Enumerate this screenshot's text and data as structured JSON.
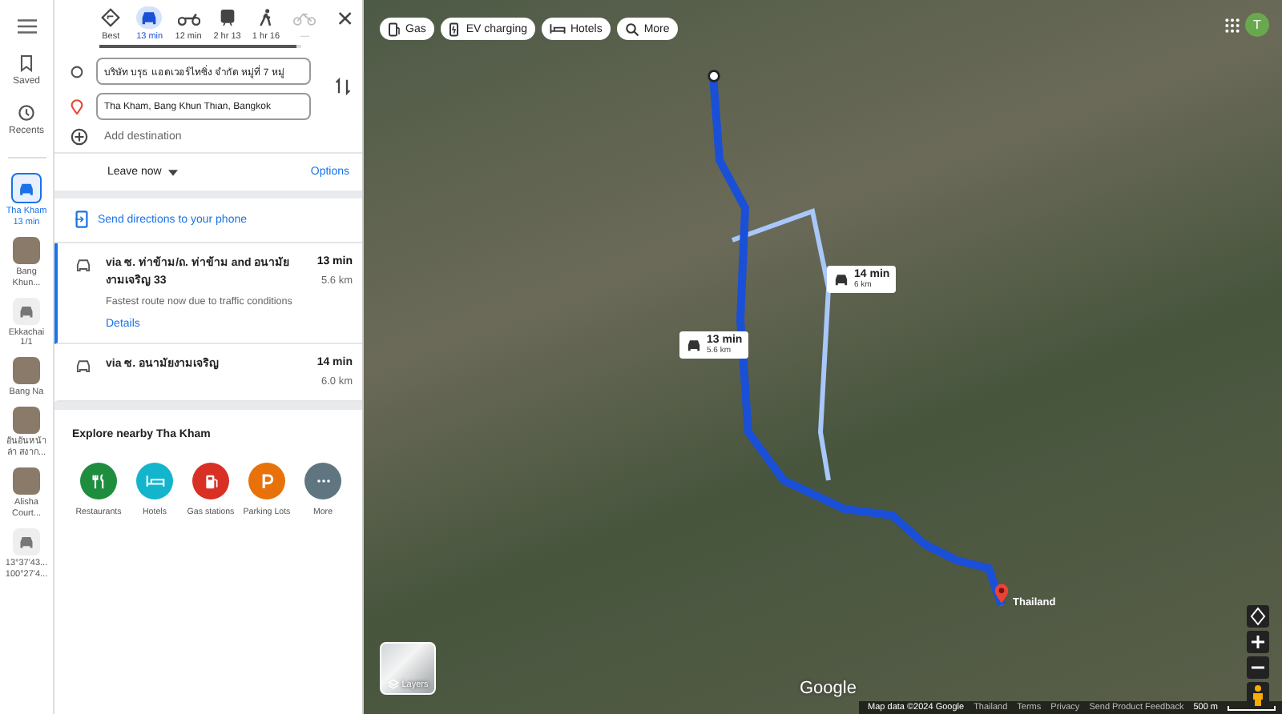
{
  "rail": {
    "saved": "Saved",
    "recents": "Recents",
    "items": [
      {
        "lines": [
          "Tha Kham",
          "13 min"
        ],
        "selected": true,
        "kind": "car"
      },
      {
        "lines": [
          "Bang",
          "Khun..."
        ],
        "selected": false,
        "kind": "photo"
      },
      {
        "lines": [
          "Ekkachai",
          "1/1"
        ],
        "selected": false,
        "kind": "place"
      },
      {
        "lines": [
          "Bang Na"
        ],
        "selected": false,
        "kind": "photo"
      },
      {
        "lines": [
          "อันอันหน้า",
          "ล่า สงาก..."
        ],
        "selected": false,
        "kind": "photo"
      },
      {
        "lines": [
          "Alisha",
          "Court..."
        ],
        "selected": false,
        "kind": "photo"
      },
      {
        "lines": [
          "13°37'43...",
          "100°27'4..."
        ],
        "selected": false,
        "kind": "place"
      }
    ]
  },
  "modes": [
    {
      "kind": "best",
      "label": "Best",
      "selected": false,
      "disabled": false
    },
    {
      "kind": "car",
      "label": "13 min",
      "selected": true,
      "disabled": false
    },
    {
      "kind": "moto",
      "label": "12 min",
      "selected": false,
      "disabled": false
    },
    {
      "kind": "transit",
      "label": "2 hr 13",
      "selected": false,
      "disabled": false
    },
    {
      "kind": "walk",
      "label": "1 hr 16",
      "selected": false,
      "disabled": false
    },
    {
      "kind": "bike",
      "label": "—",
      "selected": false,
      "disabled": true
    }
  ],
  "origin": {
    "value": "บริษัท บรุธ แอดเวอร์ไทซิ่ง จำกัด หมู่ที่ 7 หมู่"
  },
  "destination": {
    "value": "Tha Kham, Bang Khun Thian, Bangkok"
  },
  "add_destination": {
    "placeholder": "Add destination"
  },
  "leave": "Leave now",
  "options": "Options",
  "send": "Send directions to your phone",
  "routes": [
    {
      "title": "via ซ. ท่าข้าม/ถ. ท่าข้าม and อนามัย งามเจริญ 33",
      "time": "13 min",
      "distance": "5.6 km",
      "note": "Fastest route now due to traffic conditions",
      "details": "Details",
      "selected": true
    },
    {
      "title": "via ซ. อนามัยงามเจริญ",
      "time": "14 min",
      "distance": "6.0 km",
      "selected": false
    }
  ],
  "explore": {
    "title": "Explore nearby Tha Kham",
    "items": [
      {
        "kind": "restaurant",
        "label": "Restaurants",
        "color": "#1e8e3e"
      },
      {
        "kind": "hotel",
        "label": "Hotels",
        "color": "#12b5cb"
      },
      {
        "kind": "gas",
        "label": "Gas stations",
        "color": "#d93025"
      },
      {
        "kind": "parking",
        "label": "Parking Lots",
        "color": "#e8710a"
      },
      {
        "kind": "more",
        "label": "More",
        "color": "#5f7680"
      }
    ]
  },
  "chips": [
    {
      "kind": "gas",
      "label": "Gas"
    },
    {
      "kind": "ev",
      "label": "EV charging"
    },
    {
      "kind": "hotel",
      "label": "Hotels"
    },
    {
      "kind": "search",
      "label": "More"
    }
  ],
  "avatar": "T",
  "callouts": [
    {
      "time": "13 min",
      "distance": "5.6 km"
    },
    {
      "time": "14 min",
      "distance": "6 km"
    }
  ],
  "destination_label": "Thailand",
  "layers": "Layers",
  "logo": "Google",
  "attribution": [
    "Map data ©2024 Google",
    "Thailand",
    "Terms",
    "Privacy",
    "Send Product Feedback"
  ],
  "scale": "500 m"
}
